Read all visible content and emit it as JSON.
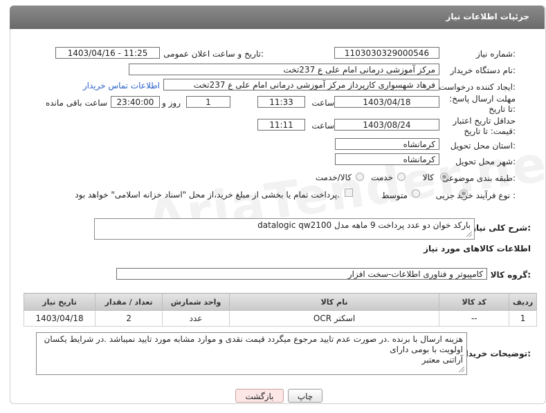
{
  "header": {
    "title": "جزئیات اطلاعات نیاز"
  },
  "fields": {
    "need_number_label": "شماره نیاز:",
    "need_number": "1103030329000546",
    "announce_label": "تاریخ و ساعت اعلان عمومی:",
    "announce_value": "1403/04/16 - 11:25",
    "buyer_org_label": "نام دستگاه خریدار:",
    "buyer_org": "مرکز آموزشی درمانی امام علی ع 237تخت",
    "creator_label": "ایجاد کننده درخواست:",
    "creator": "فرهاد شهسواری کارپرداز  مرکز آموزشی درمانی امام علی ع 237تخت",
    "contact_link": "اطلاعات تماس خریدار",
    "reply_deadline_label": "مهلت ارسال پاسخ: تا تاریخ:",
    "reply_date": "1403/04/18",
    "time_label": "ساعت",
    "reply_time": "11:33",
    "days_value": "1",
    "days_label": "روز و",
    "remaining_time": "23:40:00",
    "remaining_label": "ساعت باقی مانده",
    "price_validity_label": "حداقل تاریخ اعتبار قیمت: تا تاریخ:",
    "price_date": "1403/08/24",
    "price_time": "11:11",
    "province_label": "استان محل تحویل:",
    "province": "کرمانشاه",
    "city_label": "شهر محل تحویل:",
    "city": "کرمانشاه",
    "category_label": "طبقه بندی موضوعی:",
    "category_options": [
      "کالا",
      "خدمت",
      "کالا/خدمت"
    ],
    "process_label": "نوع فرآیند خرید :",
    "process_options": [
      "جزیی",
      "متوسط"
    ],
    "payment_text": "پرداخت تمام یا بخشی از مبلغ خرید،از محل \"اسناد خزانه اسلامی\" خواهد بود."
  },
  "description": {
    "label": "شرح کلی نیاز:",
    "text": "بارکد خوان دو عدد پرداخت 9 ماهه  مدل  datalogic qw2100"
  },
  "goods_section_title": "اطلاعات کالاهای مورد نیاز",
  "goods_group": {
    "label": "گروه کالا:",
    "value": "کامپیوتر و فناوری اطلاعات-سخت افزار"
  },
  "table": {
    "headers": [
      "ردیف",
      "کد کالا",
      "نام کالا",
      "واحد شمارش",
      "تعداد / مقدار",
      "تاریخ نیاز"
    ],
    "rows": [
      [
        "1",
        "--",
        "اسکنر OCR",
        "عدد",
        "2",
        "1403/04/18"
      ]
    ]
  },
  "buyer_notes": {
    "label": "توضیحات خریدار:",
    "line1": "هزینه ارسال با برنده .در صورت عدم تایید مرجوع میگردد قیمت نقدی و موارد مشابه مورد تایید نمیباشد .در شرایط یکسان",
    "line2": "اولویت با بومی  دارای",
    "line3": "آراتنی معتبر"
  },
  "buttons": {
    "print": "چاپ",
    "back": "بازگشت"
  },
  "watermark": "AriaTender.net",
  "colors": {
    "header_bg": "#7a7a7a",
    "link": "#2a62c9",
    "back_btn_bg": "#fde6e6"
  }
}
